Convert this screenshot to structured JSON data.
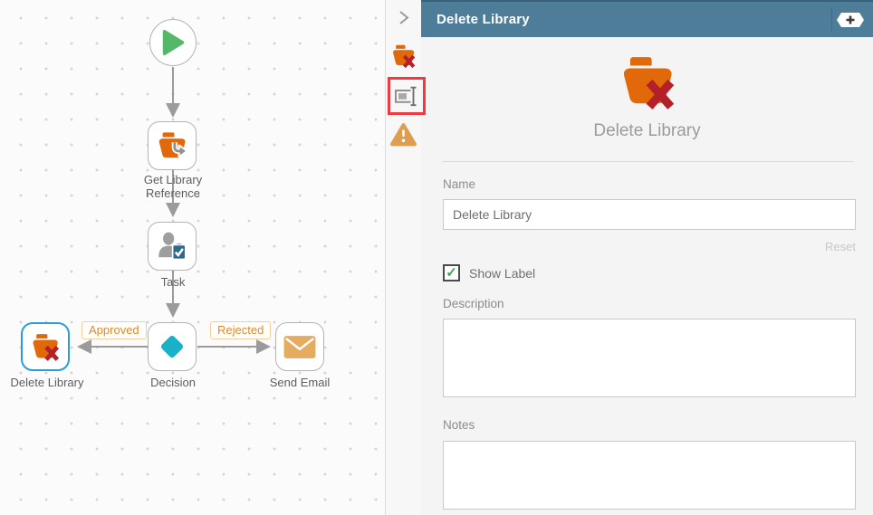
{
  "canvas": {
    "nodes": [
      {
        "id": "start",
        "label": "",
        "icon": "play-icon"
      },
      {
        "id": "get-library-reference",
        "label": "Get Library Reference",
        "icon": "folder-reference-icon"
      },
      {
        "id": "task",
        "label": "Task",
        "icon": "user-task-icon"
      },
      {
        "id": "decision",
        "label": "Decision",
        "icon": "decision-diamond-icon"
      },
      {
        "id": "delete-library",
        "label": "Delete Library",
        "icon": "delete-library-folder-icon",
        "selected": true
      },
      {
        "id": "send-email",
        "label": "Send Email",
        "icon": "email-icon"
      }
    ],
    "branch_labels": {
      "approved": "Approved",
      "rejected": "Rejected"
    }
  },
  "rail": {
    "collapse_icon": "chevron-right-icon",
    "tabs": [
      {
        "icon": "delete-library-step-icon"
      },
      {
        "icon": "rename-label-icon",
        "annotated": true
      },
      {
        "icon": "warning-icon"
      }
    ]
  },
  "panel": {
    "header": {
      "title": "Delete Library",
      "add_icon": "plus-hexagon-icon"
    },
    "hero": {
      "title": "Delete Library",
      "icon": "delete-library-folder-icon"
    },
    "form": {
      "name_label": "Name",
      "name_value": "Delete Library",
      "reset_label": "Reset",
      "show_label_text": "Show Label",
      "show_label_checked": true,
      "description_label": "Description",
      "description_value": "",
      "notes_label": "Notes",
      "notes_value": ""
    }
  },
  "colors": {
    "header_bg": "#4e7d9a",
    "accent_orange": "#e2690a",
    "danger_red": "#b32028",
    "selected_blue": "#2a9ddc",
    "decision_teal": "#18b1c7",
    "start_green": "#55b769",
    "warning_amber": "#dd9e4f",
    "email_tan": "#e5ab5e",
    "annotation_red": "#ee3b42",
    "branch_label_orange": "#e08932"
  }
}
